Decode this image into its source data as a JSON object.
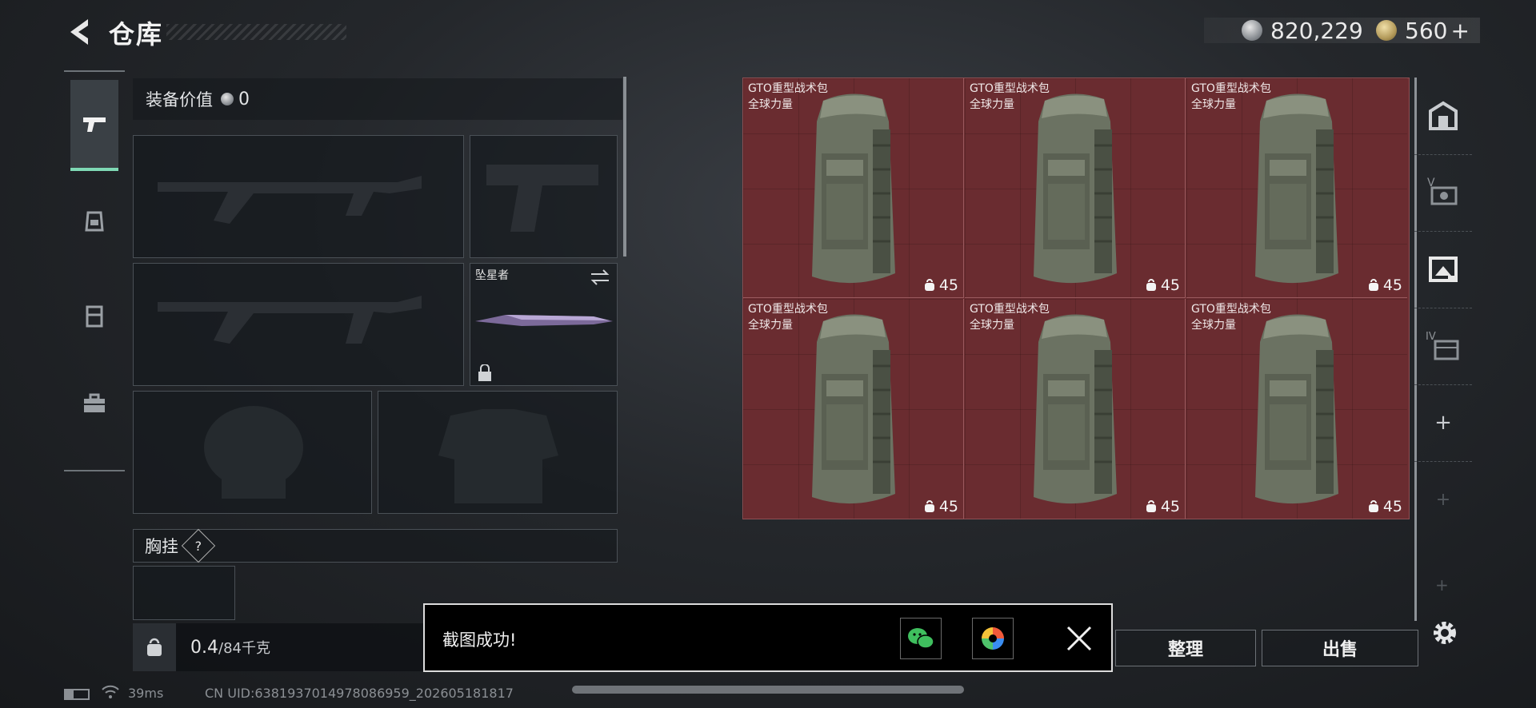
{
  "header": {
    "title": "仓库",
    "currency_silver": "820,229",
    "currency_gold": "560",
    "add_label": "+"
  },
  "equipment": {
    "value_label": "装备价值",
    "value": "0",
    "melee_slot_name": "坠星者",
    "chest_rig_label": "胸挂",
    "help_label": "?",
    "weight_current": "0.4",
    "weight_max": "/84千克"
  },
  "storage": {
    "items": [
      {
        "name": "GTO重型战术包",
        "brand": "全球力量",
        "count": "45"
      },
      {
        "name": "GTO重型战术包",
        "brand": "全球力量",
        "count": "45"
      },
      {
        "name": "GTO重型战术包",
        "brand": "全球力量",
        "count": "45"
      },
      {
        "name": "GTO重型战术包",
        "brand": "全球力量",
        "count": "45"
      },
      {
        "name": "GTO重型战术包",
        "brand": "全球力量",
        "count": "45"
      },
      {
        "name": "GTO重型战术包",
        "brand": "全球力量",
        "count": "45"
      }
    ]
  },
  "right_rail": {
    "labels": [
      "",
      "V",
      "",
      "IV",
      "+",
      "+",
      "+"
    ],
    "icons": [
      "armory-icon",
      "storage-v-icon",
      "storage-image-icon",
      "storage-iv-icon",
      "add-icon",
      "add-icon",
      "add-icon"
    ]
  },
  "buttons": {
    "sort": "整理",
    "sell": "出售"
  },
  "toast": {
    "message": "截图成功!"
  },
  "status_bar": {
    "ping": "39ms",
    "uid": "CN UID:6381937014978086959_202605181817"
  },
  "colors": {
    "accent": "#7fd9b5",
    "storage_bg": "#6a2c30"
  }
}
